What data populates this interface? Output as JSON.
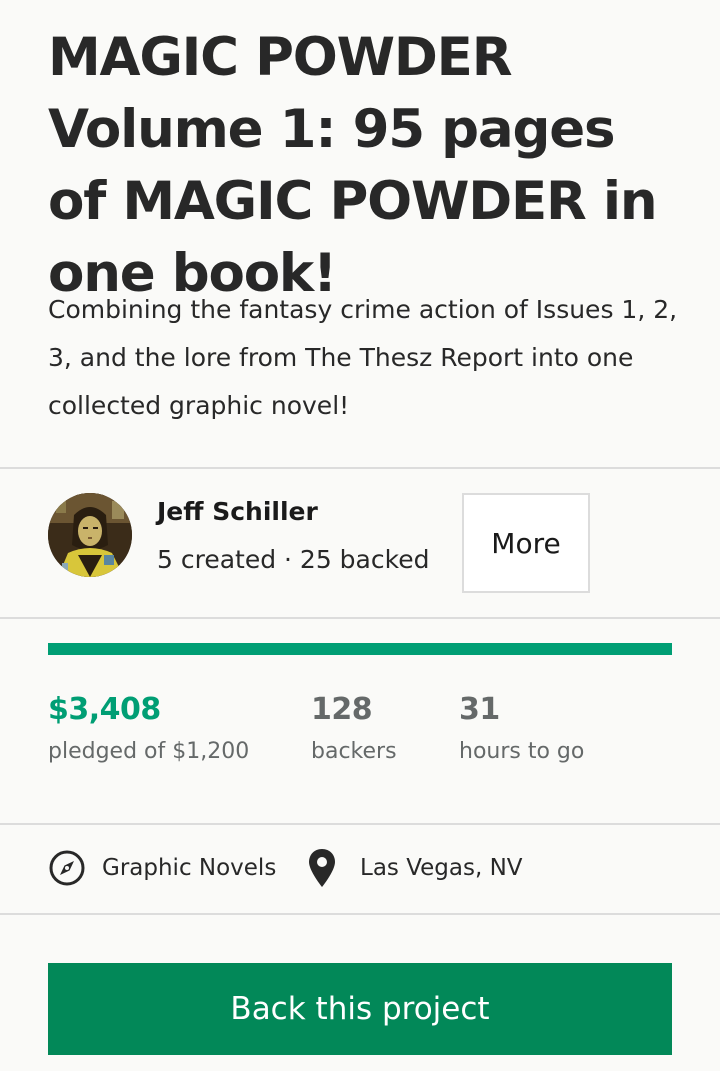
{
  "project": {
    "title": "MAGIC POWDER Volume 1: 95 pages of MAGIC POWDER in one book!",
    "blurb": "Combining the fantasy crime action of Issues 1, 2, 3, and the lore from The Thesz Report into one collected graphic novel!"
  },
  "creator": {
    "name": "Jeff Schiller",
    "stats": "5 created · 25 backed",
    "more_label": "More",
    "avatar_icon": "avatar-portrait"
  },
  "funding": {
    "progress_fraction": 1.0,
    "pledged_amount": "$3,408",
    "pledged_label": "pledged of $1,200",
    "backers_count": "128",
    "backers_label": "backers",
    "time_value": "31",
    "time_label": "hours to go"
  },
  "meta": {
    "category": "Graphic Novels",
    "category_icon": "compass-icon",
    "location": "Las Vegas, NV",
    "location_icon": "map-pin-icon"
  },
  "cta": {
    "back_label": "Back this project"
  },
  "colors": {
    "accent_green": "#009e74",
    "button_green": "#028858",
    "text_dark": "#282828",
    "text_muted": "#656969",
    "divider": "#dcdcdc",
    "background": "#fafaf8"
  }
}
